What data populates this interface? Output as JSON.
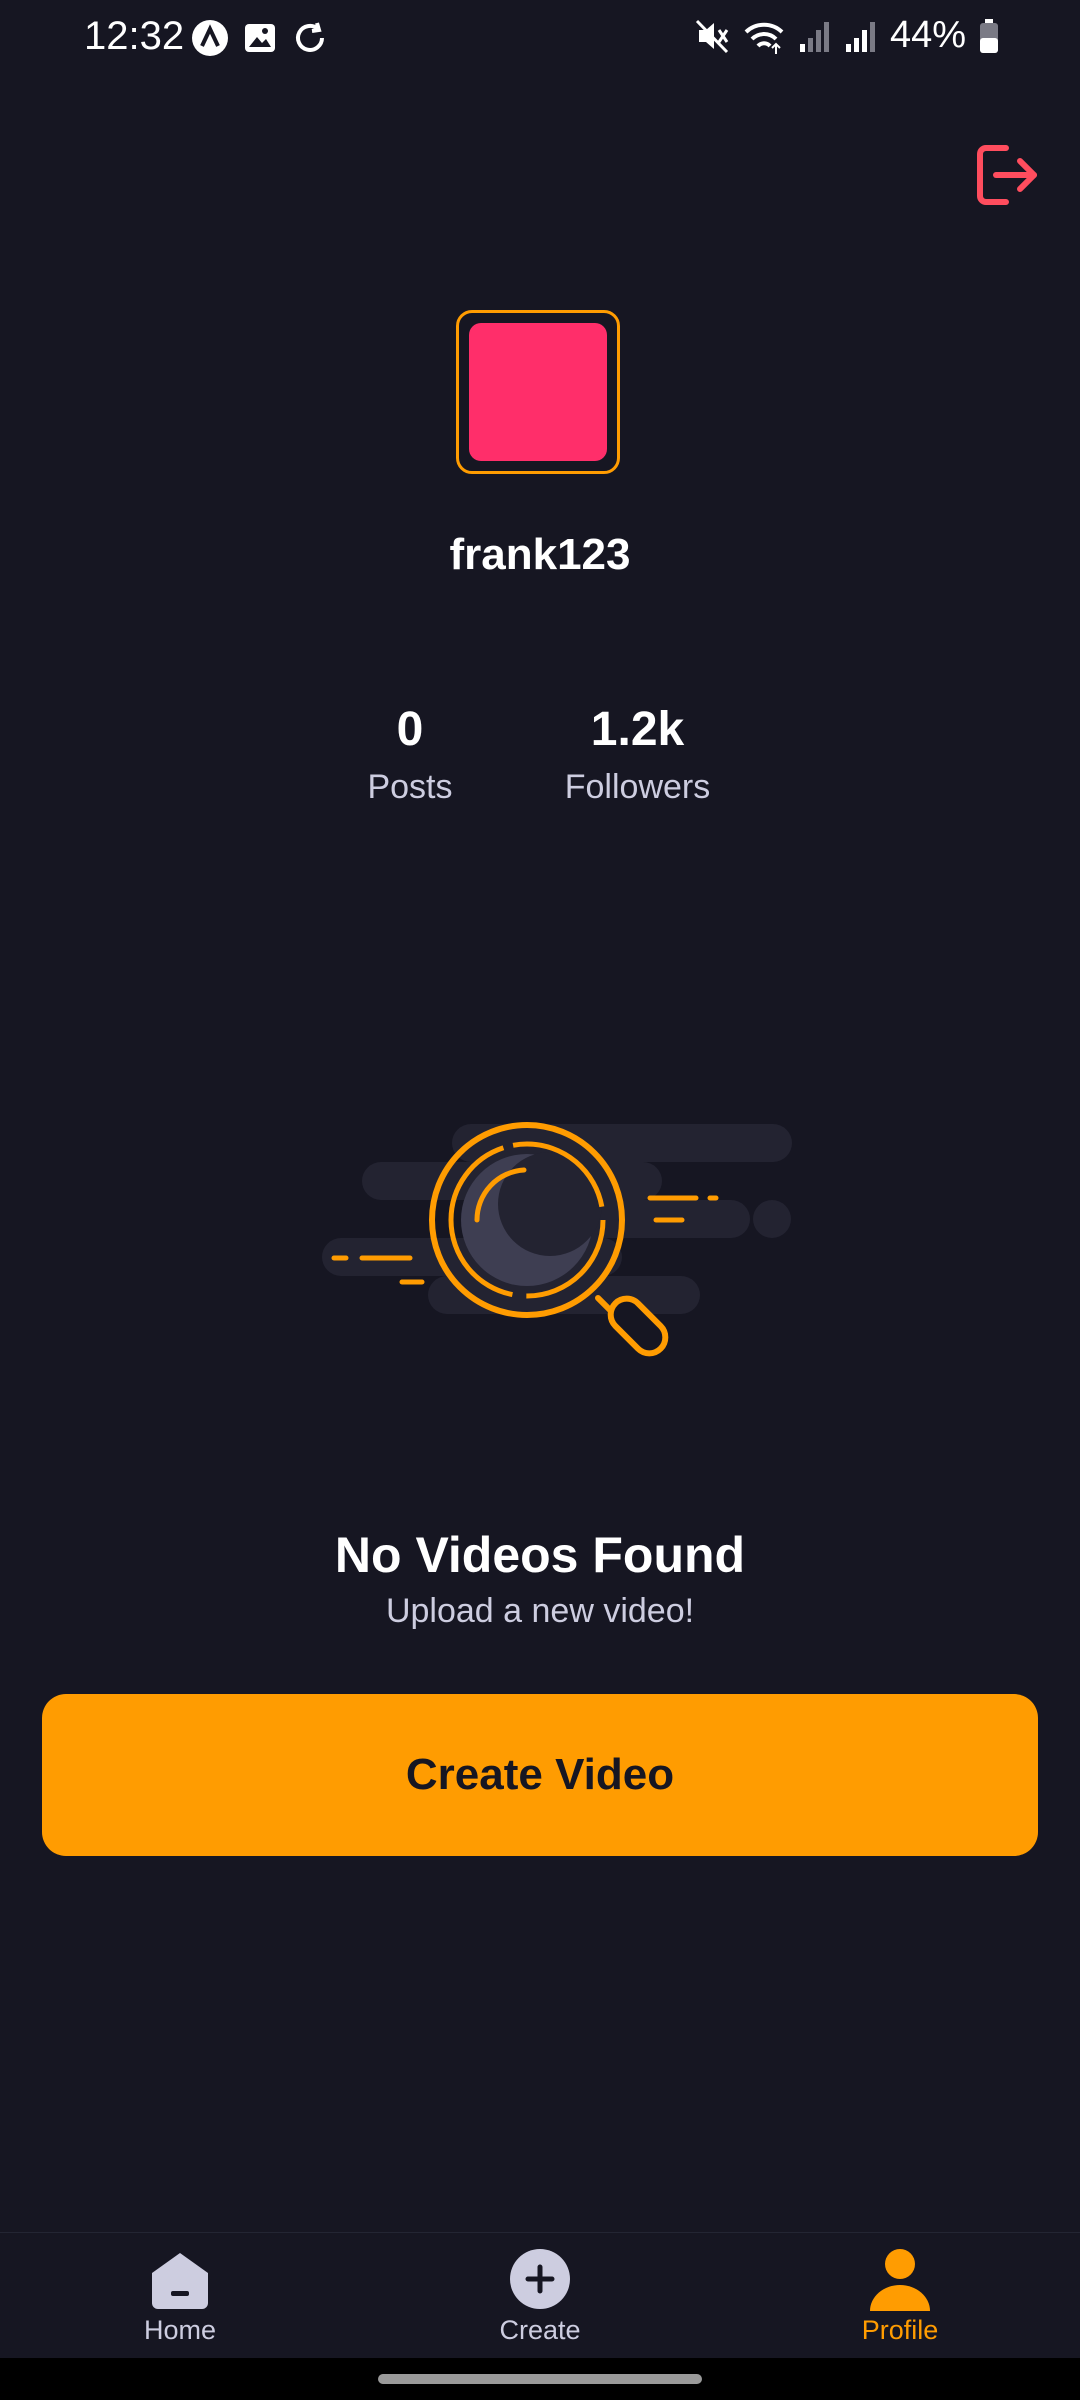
{
  "status_bar": {
    "time": "12:32",
    "battery": "44%"
  },
  "profile": {
    "username": "frank123",
    "avatar_color": "#FF2E6A",
    "accent_color": "#FF9C01",
    "stats": [
      {
        "value": "0",
        "label": "Posts"
      },
      {
        "value": "1.2k",
        "label": "Followers"
      }
    ]
  },
  "empty_state": {
    "title": "No Videos Found",
    "subtitle": "Upload a new video!",
    "button_label": "Create Video"
  },
  "bottom_nav": {
    "items": [
      {
        "label": "Home",
        "icon": "home-icon",
        "active": false
      },
      {
        "label": "Create",
        "icon": "plus-icon",
        "active": false
      },
      {
        "label": "Profile",
        "icon": "profile-icon",
        "active": true
      }
    ]
  },
  "colors": {
    "background": "#161622",
    "primary": "#FF9C01",
    "logout": "#FF4D5E",
    "muted_text": "#CDCDE0"
  }
}
